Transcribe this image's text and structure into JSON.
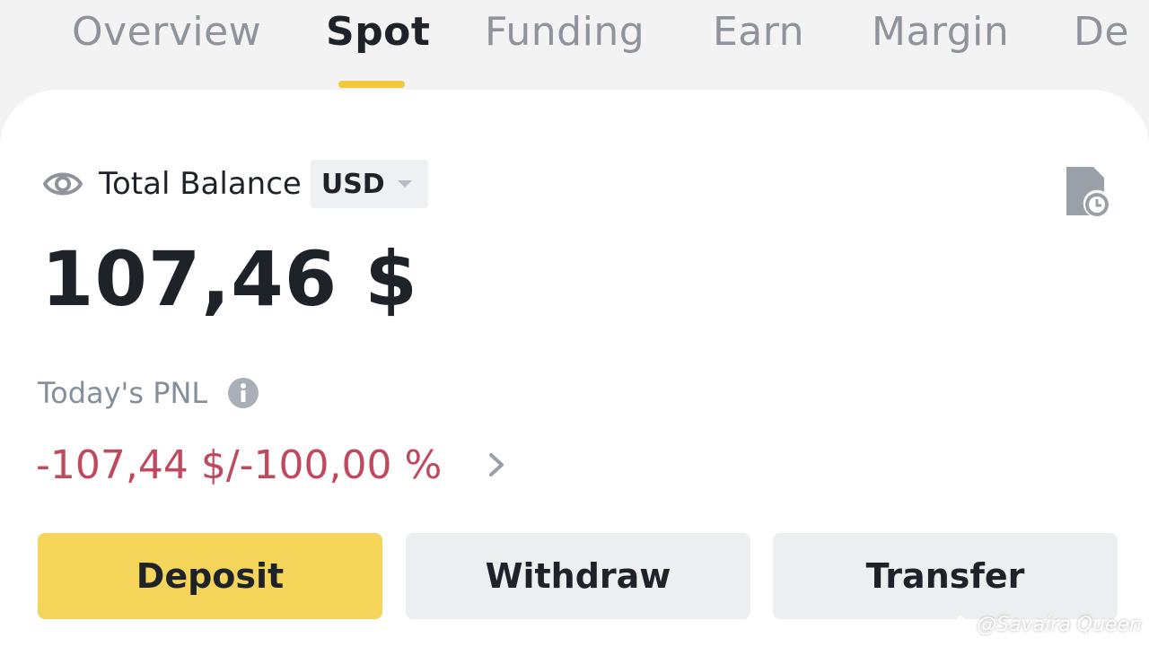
{
  "tabs": [
    {
      "label": "Overview",
      "active": false
    },
    {
      "label": "Spot",
      "active": true
    },
    {
      "label": "Funding",
      "active": false
    },
    {
      "label": "Earn",
      "active": false
    },
    {
      "label": "Margin",
      "active": false
    },
    {
      "label": "De",
      "active": false
    }
  ],
  "balance": {
    "label": "Total Balance",
    "currency": "USD",
    "amount": "107,46 $",
    "icons": {
      "visibility": "eye-icon",
      "history": "document-clock-icon"
    }
  },
  "pnl": {
    "label": "Today's PNL",
    "value": "-107,44 $/-100,00 %",
    "icons": {
      "info": "info-icon",
      "details": "chevron-right-icon"
    }
  },
  "actions": {
    "deposit": "Deposit",
    "withdraw": "Withdraw",
    "transfer": "Transfer"
  },
  "watermark": "@Savaira Queen",
  "colors": {
    "accent": "#f0c93c",
    "deposit_bg": "#f5d45a",
    "negative": "#c0495d",
    "secondary_button_bg": "#eceef0",
    "muted_text": "#848e9c"
  }
}
